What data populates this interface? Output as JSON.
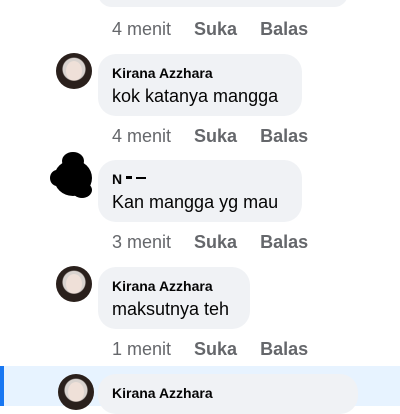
{
  "thread": {
    "top_meta": {
      "time": "4 menit",
      "like": "Suka",
      "reply": "Balas"
    },
    "comments": [
      {
        "author": "Kirana Azzhara",
        "text": "kok katanya mangga",
        "time": "4 menit",
        "like": "Suka",
        "reply": "Balas"
      },
      {
        "author": "N",
        "text": "Kan mangga yg mau",
        "time": "3 menit",
        "like": "Suka",
        "reply": "Balas"
      },
      {
        "author": "Kirana Azzhara",
        "text": "maksutnya teh",
        "time": "1 menit",
        "like": "Suka",
        "reply": "Balas"
      },
      {
        "author": "Kirana Azzhara"
      }
    ]
  },
  "colors": {
    "bubble": "#f0f2f5",
    "meta": "#65676b",
    "highlight": "#e7f3ff",
    "accent": "#1877f2"
  },
  "icons": {
    "avatar": "profile-photo",
    "redacted_avatar": "redaction-scribble"
  }
}
